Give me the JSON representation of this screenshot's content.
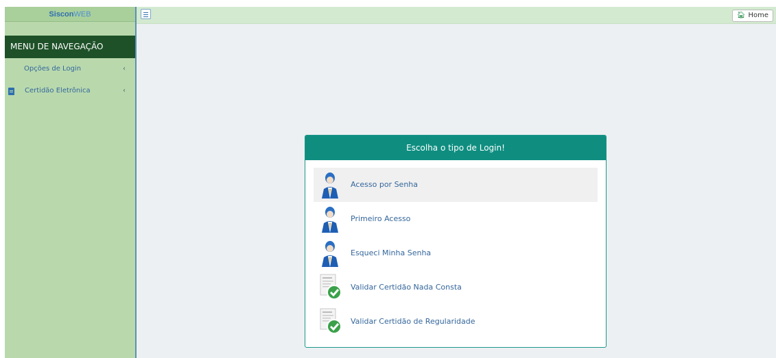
{
  "brand": {
    "part1": "Siscon",
    "part2": "WEB"
  },
  "sidebar": {
    "menu_header": "MENU DE NAVEGAÇÃO",
    "items": [
      {
        "label": "Opções de Login",
        "chevron": "‹"
      },
      {
        "label": "Certidão Eletrônica",
        "chevron": "‹",
        "icon": "document-icon"
      }
    ]
  },
  "topbar": {
    "home_label": "Home",
    "home_icon": "home-icon"
  },
  "login_card": {
    "title": "Escolha o tipo de Login!",
    "options": [
      {
        "label": "Acesso por Senha",
        "icon": "user-icon",
        "active": true
      },
      {
        "label": "Primeiro Acesso",
        "icon": "user-icon"
      },
      {
        "label": "Esqueci Minha Senha",
        "icon": "user-icon"
      },
      {
        "label": "Validar Certidão Nada Consta",
        "icon": "certificate-check-icon"
      },
      {
        "label": "Validar Certidão de Regularidade",
        "icon": "certificate-check-icon"
      }
    ]
  },
  "colors": {
    "sidebar_bg": "#b9d9ad",
    "menu_header_bg": "#1e5128",
    "card_header_bg": "#0f8e80",
    "link_text": "#34669b"
  }
}
